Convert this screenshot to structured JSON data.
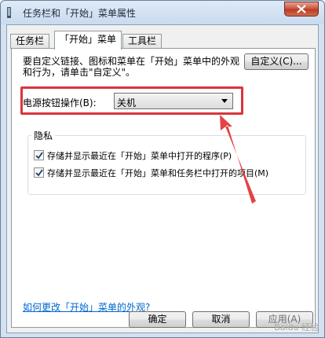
{
  "window": {
    "title": "任务栏和「开始」菜单属性"
  },
  "tabs": [
    {
      "label": "任务栏"
    },
    {
      "label": "「开始」菜单"
    },
    {
      "label": "工具栏"
    }
  ],
  "start_menu": {
    "intro_text": "要自定义链接、图标和菜单在「开始」菜单中的外观和行为，请单击\"自定义\"。",
    "customize_button": "自定义(C)...",
    "power_label": "电源按钮操作(B):",
    "power_value": "关机",
    "privacy": {
      "title": "隐私",
      "items": [
        {
          "label": "存储并显示最近在「开始」菜单中打开的程序(P)",
          "checked": true
        },
        {
          "label": "存储并显示最近在「开始」菜单和任务栏中打开的项目(M)",
          "checked": true
        }
      ]
    },
    "help_link": "如何更改「开始」菜单的外观?"
  },
  "footer": {
    "ok": "确定",
    "cancel": "取消",
    "apply": "应用(A)"
  },
  "watermark": "Baidu 经验",
  "colors": {
    "highlight": "#d9353b",
    "link": "#0066cc"
  }
}
